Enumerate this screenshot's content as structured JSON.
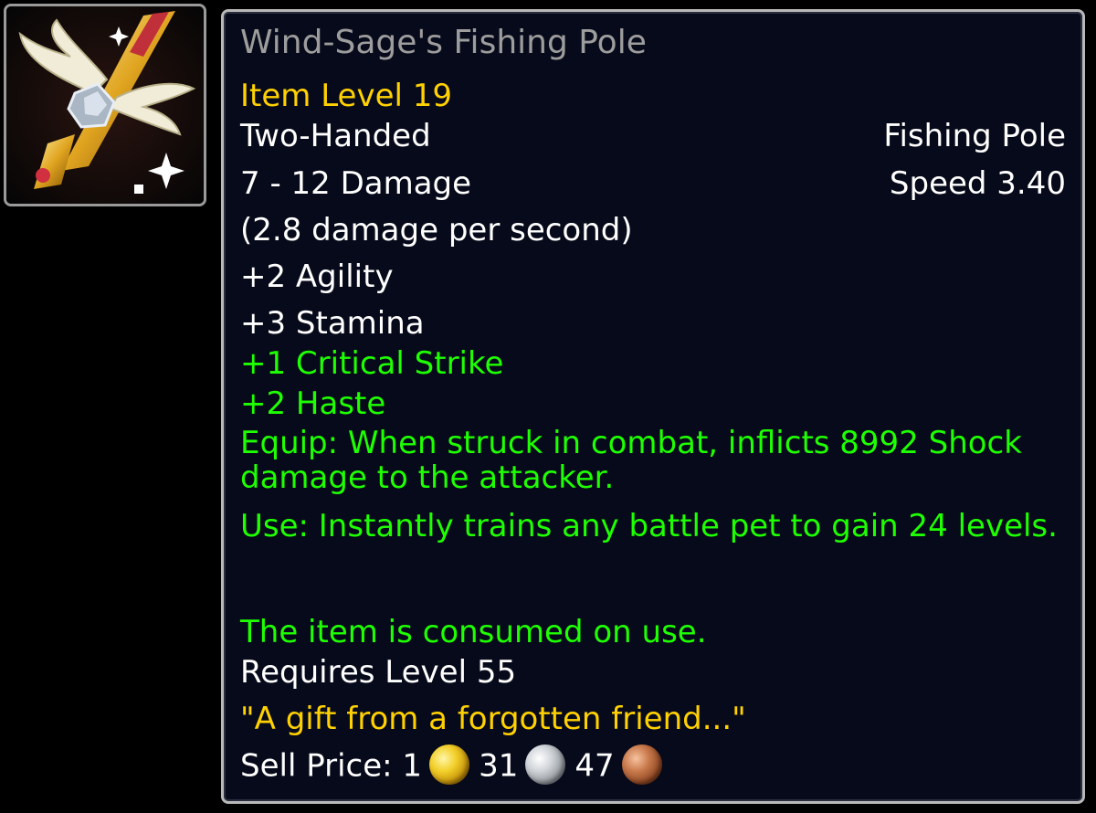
{
  "item": {
    "icon": "winged-fishing-pole-icon",
    "name": "Wind-Sage's Fishing Pole",
    "name_color": "#9d9d9d",
    "item_level": "Item Level 19",
    "slot": "Two-Handed",
    "type": "Fishing Pole",
    "damage": "7 - 12 Damage",
    "speed": "Speed 3.40",
    "dps": "(2.8 damage per second)",
    "stats": [
      "+2 Agility",
      "+3 Stamina"
    ],
    "bonus_stats": [
      "+1 Critical Strike",
      "+2 Haste"
    ],
    "equip_effect": "Equip: When struck in combat, inflicts 8992 Shock damage to the attacker.",
    "use_effect": "Use: Instantly trains any battle pet to gain 24 levels.",
    "consumed_note": "The item is consumed on use.",
    "requirement": "Requires Level 55",
    "flavor_text": "\"A gift from a forgotten friend...\"",
    "sell_price": {
      "label": "Sell Price:",
      "gold": "1",
      "silver": "31",
      "copper": "47"
    }
  },
  "colors": {
    "item_level": "#ffd100",
    "bonus": "#1eff00",
    "tooltip_bg": "#070a1a",
    "border": "#b8b8b8"
  }
}
